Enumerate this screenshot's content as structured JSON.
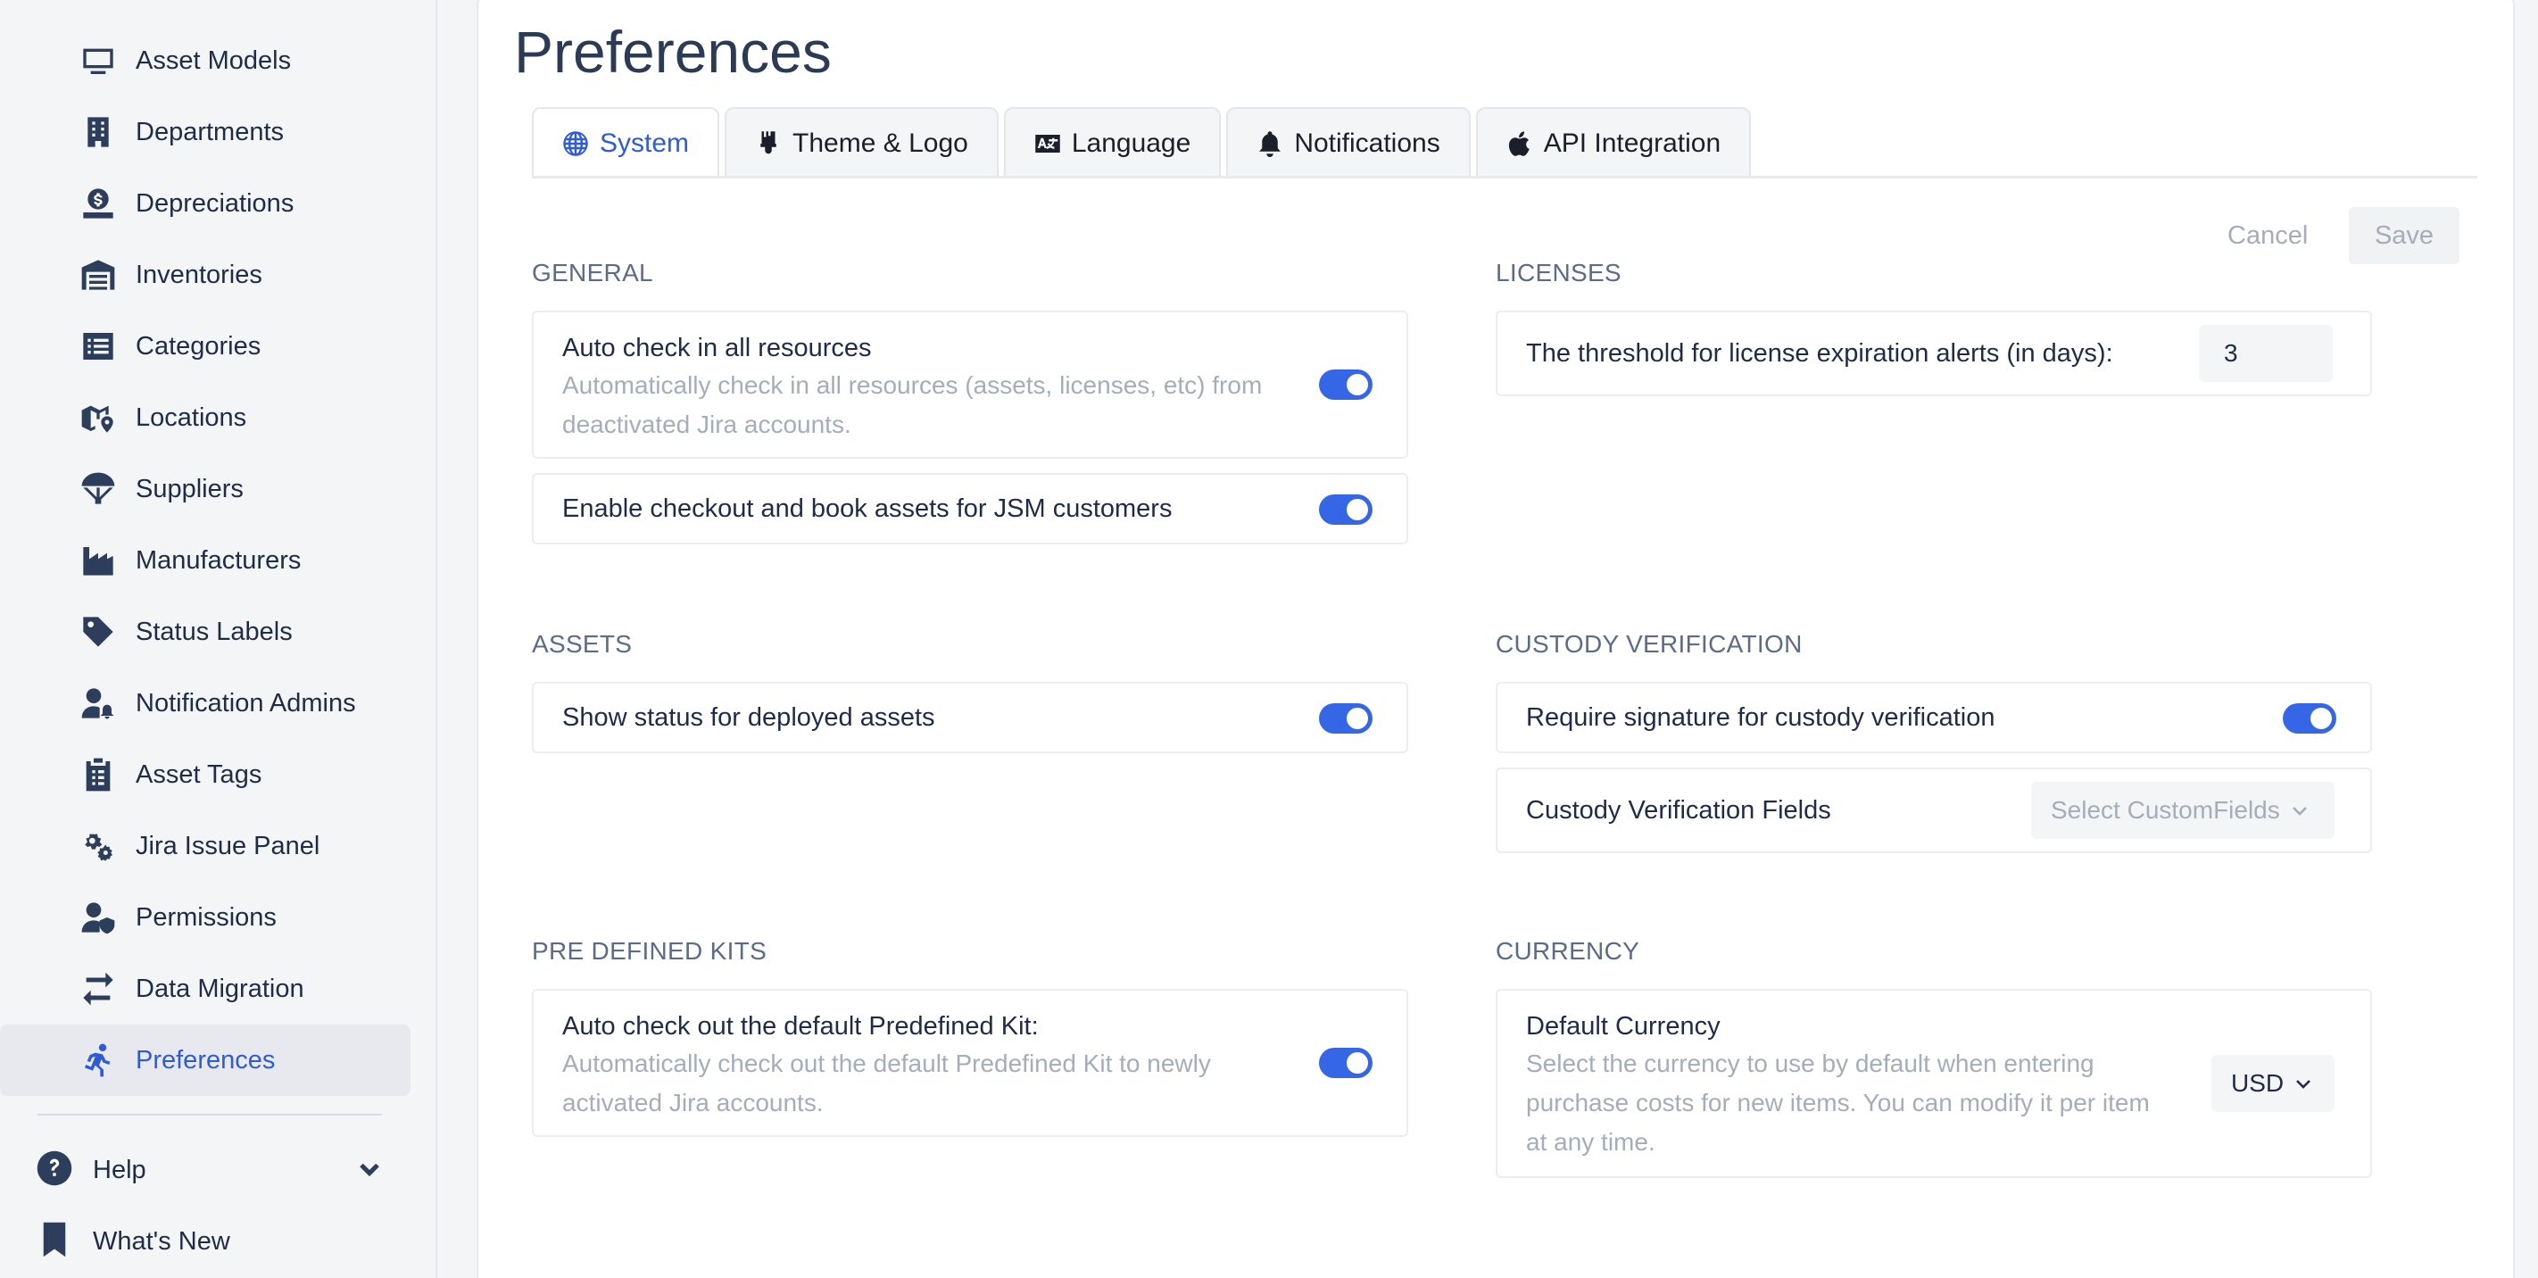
{
  "sidebar": {
    "items": [
      {
        "label": "Asset Models",
        "icon": "monitor-icon"
      },
      {
        "label": "Departments",
        "icon": "building-icon"
      },
      {
        "label": "Depreciations",
        "icon": "money-hand-icon"
      },
      {
        "label": "Inventories",
        "icon": "warehouse-icon"
      },
      {
        "label": "Categories",
        "icon": "list-icon"
      },
      {
        "label": "Locations",
        "icon": "map-pin-icon"
      },
      {
        "label": "Suppliers",
        "icon": "parachute-icon"
      },
      {
        "label": "Manufacturers",
        "icon": "factory-icon"
      },
      {
        "label": "Status Labels",
        "icon": "tag-icon"
      },
      {
        "label": "Notification Admins",
        "icon": "user-bell-icon"
      },
      {
        "label": "Asset Tags",
        "icon": "clipboard-icon"
      },
      {
        "label": "Jira Issue Panel",
        "icon": "gears-icon"
      },
      {
        "label": "Permissions",
        "icon": "user-shield-icon"
      },
      {
        "label": "Data Migration",
        "icon": "swap-arrows-icon"
      },
      {
        "label": "Preferences",
        "icon": "running-person-icon",
        "active": true
      }
    ],
    "help_label": "Help",
    "whats_new_label": "What's New"
  },
  "main": {
    "title": "Preferences",
    "tabs": [
      {
        "label": "System",
        "icon": "globe-icon",
        "active": true
      },
      {
        "label": "Theme & Logo",
        "icon": "paintbrush-icon"
      },
      {
        "label": "Language",
        "icon": "language-icon"
      },
      {
        "label": "Notifications",
        "icon": "bell-icon"
      },
      {
        "label": "API Integration",
        "icon": "apple-icon"
      }
    ],
    "cancel_label": "Cancel",
    "save_label": "Save"
  },
  "general": {
    "heading": "GENERAL",
    "auto_checkin_title": "Auto check in all resources",
    "auto_checkin_desc_1": "Automatically check in all resources (assets, licenses, etc) from",
    "auto_checkin_desc_2": "deactivated Jira accounts.",
    "auto_checkin_enabled": true,
    "checkout_jsm_title": "Enable checkout and book assets for JSM customers",
    "checkout_jsm_enabled": true
  },
  "licenses": {
    "heading": "LICENSES",
    "threshold_label": "The threshold for license expiration alerts (in days):",
    "threshold_value": "3"
  },
  "assets": {
    "heading": "ASSETS",
    "show_status_label": "Show status for deployed assets",
    "show_status_enabled": true
  },
  "custody": {
    "heading": "CUSTODY VERIFICATION",
    "require_signature_label": "Require signature for custody verification",
    "require_signature_enabled": true,
    "fields_label": "Custody Verification Fields",
    "fields_placeholder": "Select CustomFields"
  },
  "kits": {
    "heading": "PRE DEFINED KITS",
    "auto_checkout_title": "Auto check out the default Predefined Kit:",
    "auto_checkout_desc_1": "Automatically check out the default Predefined Kit to newly",
    "auto_checkout_desc_2": "activated Jira accounts.",
    "auto_checkout_enabled": true
  },
  "currency": {
    "heading": "CURRENCY",
    "default_title": "Default Currency",
    "desc_1": "Select the currency to use by default when entering",
    "desc_2": "purchase costs for new items. You can modify it per item",
    "desc_3": "at any time.",
    "selected": "USD"
  },
  "colors": {
    "accent": "#2f5bd7",
    "toggle_on": "#3566e6",
    "sidebar_bg": "#f4f5f7"
  }
}
